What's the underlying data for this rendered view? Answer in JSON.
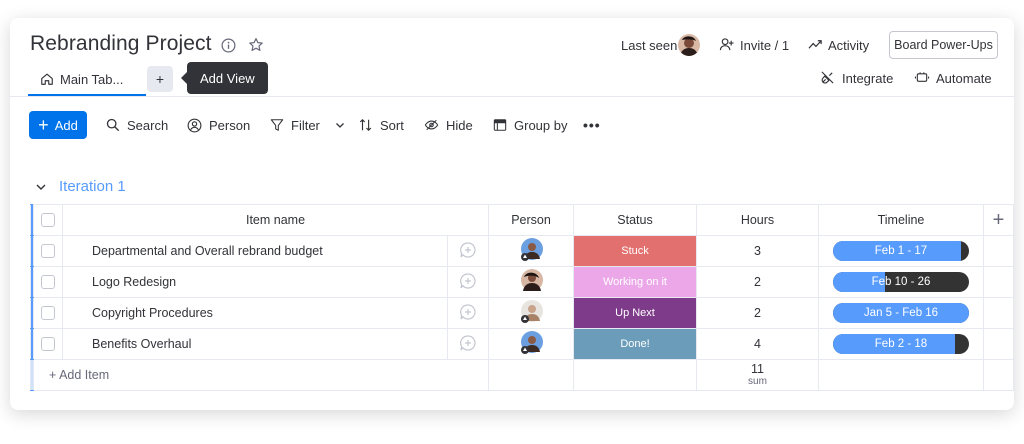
{
  "header": {
    "title": "Rebranding Project",
    "last_seen_label": "Last seen",
    "invite_label": "Invite / 1",
    "activity_label": "Activity",
    "power_ups_label": "Board Power-Ups",
    "integrate_label": "Integrate",
    "automate_label": "Automate"
  },
  "tabs": {
    "main_tab_label": "Main Tab...",
    "add_view_symbol": "+",
    "tooltip": "Add View"
  },
  "toolbar": {
    "add_label": "Add",
    "search_label": "Search",
    "person_label": "Person",
    "filter_label": "Filter",
    "sort_label": "Sort",
    "hide_label": "Hide",
    "group_by_label": "Group by",
    "more_label": "•••"
  },
  "group": {
    "title": "Iteration 1",
    "color": "#579bfc",
    "columns": {
      "item_name": "Item name",
      "person": "Person",
      "status": "Status",
      "hours": "Hours",
      "timeline": "Timeline",
      "add": "+"
    },
    "rows": [
      {
        "name": "Departmental and Overall rebrand budget",
        "status": "Stuck",
        "status_color": "#e2706e",
        "hours": "3",
        "timeline": "Feb 1 - 17",
        "timeline_progress": 0.94
      },
      {
        "name": "Logo Redesign",
        "status": "Working on it",
        "status_color": "#eba7e8",
        "hours": "2",
        "timeline": "Feb 10 - 26",
        "timeline_progress": 0.38
      },
      {
        "name": "Copyright Procedures",
        "status": "Up Next",
        "status_color": "#7e3b8a",
        "hours": "2",
        "timeline": "Jan 5 - Feb 16",
        "timeline_progress": 1.0
      },
      {
        "name": "Benefits Overhaul",
        "status": "Done!",
        "status_color": "#6b9dba",
        "hours": "4",
        "timeline": "Feb 2 - 18",
        "timeline_progress": 0.9
      }
    ],
    "add_item_label": "+ Add Item",
    "hours_sum": "11",
    "sum_label": "sum"
  },
  "colors": {
    "accent": "#0073ea",
    "group_blue": "#579bfc",
    "timeline_remaining": "#333333"
  }
}
